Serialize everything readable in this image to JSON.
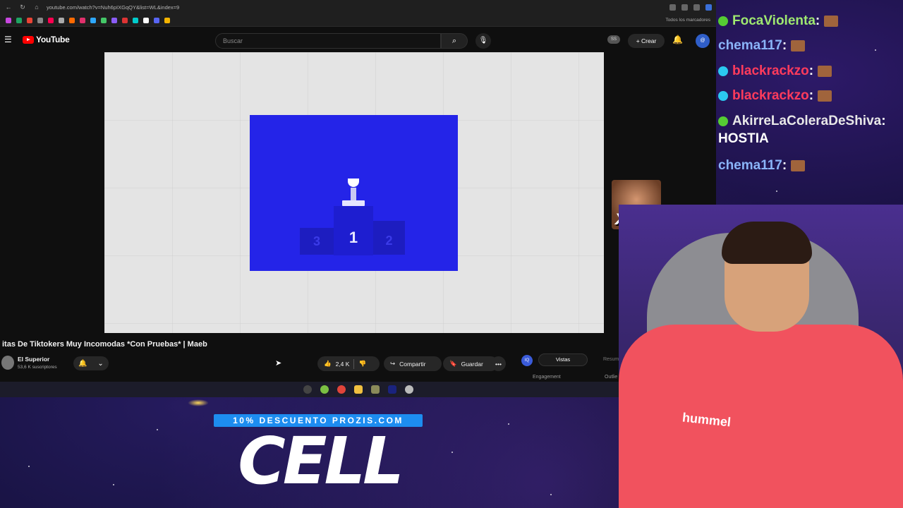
{
  "browser": {
    "url": "youtube.com/watch?v=Nuh6pIXGqQY&list=WL&index=9",
    "bookmarks_right": "Todos los marcadores"
  },
  "youtube": {
    "logo_text": "YouTube",
    "search_placeholder": "Buscar",
    "ss_badge": "SS",
    "create_label": "Crear",
    "avatar_text": "@"
  },
  "video": {
    "title": "itas De Tiktokers Muy Incomodas *Con Pruebas* | Maeb",
    "podium": {
      "first": "1",
      "second": "2",
      "third": "3"
    },
    "channel_name": "El Superior",
    "subscribers": "53,6 K suscriptores",
    "likes": "2,4 K",
    "share_label": "Compartir",
    "save_label": "Guardar",
    "more_label": "•••"
  },
  "side_widget": {
    "logo": "IQ",
    "tab_active": "Vistas",
    "tab_other": "Resum",
    "engagement": "Engagement",
    "outlier": "Outlie"
  },
  "chat": {
    "messages": [
      {
        "user": "FocaViolenta",
        "sep": " :",
        "color": "#9fe870",
        "badge": "#55cc33"
      },
      {
        "user": "chema117",
        "sep": " :",
        "color": "#8ab4f8",
        "badge": ""
      },
      {
        "user": "blackrackzo",
        "sep": " :",
        "color": "#ff3b5c",
        "badge": "#2bc8f0"
      },
      {
        "user": "blackrackzo",
        "sep": " :",
        "color": "#ff3b5c",
        "badge": "#2bc8f0"
      },
      {
        "user": "AkirreLaColeraDeShiva",
        "sep": " :",
        "color": "#e8e8e8",
        "badge": "#55cc33",
        "text": "HOSTIA"
      },
      {
        "user": "chema117",
        "sep": " :",
        "color": "#8ab4f8",
        "badge": ""
      }
    ]
  },
  "overlay": {
    "emote_count": "x13",
    "promo": "10% DESCUENTO PROZIS.COM",
    "logo": "CELL",
    "shirt_brand": "hummel"
  }
}
